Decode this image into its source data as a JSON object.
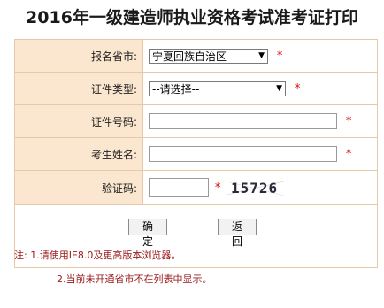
{
  "page": {
    "title": "2016年一级建造师执业资格考试准考证打印"
  },
  "form": {
    "province": {
      "label": "报名省市:",
      "selected": "宁夏回族自治区",
      "required_mark": "*"
    },
    "id_type": {
      "label": "证件类型:",
      "selected": "--请选择--",
      "required_mark": "*"
    },
    "id_number": {
      "label": "证件号码:",
      "value": "",
      "required_mark": "*"
    },
    "name": {
      "label": "考生姓名:",
      "value": "",
      "required_mark": "*"
    },
    "captcha": {
      "label": "验证码:",
      "value": "",
      "required_mark": "*",
      "image_text": "15726"
    }
  },
  "buttons": {
    "confirm": "确 定",
    "back": "返 回"
  },
  "notes": {
    "note1": "注: 1.请使用IE8.0及更高版本浏览器。",
    "note2": "2.当前未开通省市不在列表中显示。"
  },
  "colors": {
    "label_bg": "#fbe7cf",
    "border": "#e6c9a8",
    "required": "#e00000",
    "note_text": "#9a1a1a"
  }
}
